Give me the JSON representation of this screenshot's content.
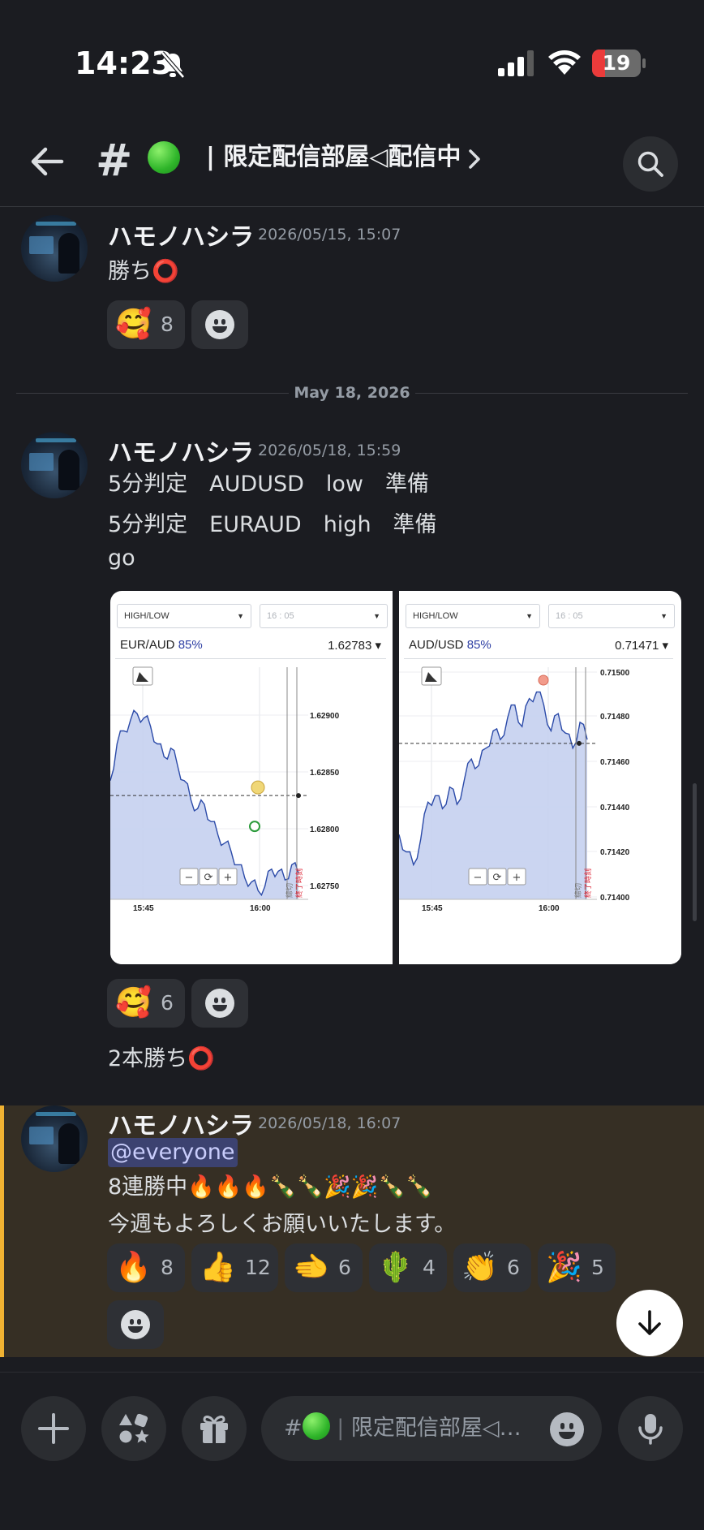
{
  "status_bar": {
    "time": "14:23",
    "battery": "19"
  },
  "header": {
    "hash": "#",
    "channel_name": "| 限定配信部屋◁配信中"
  },
  "messages": [
    {
      "author": "ハモノハシラ",
      "timestamp": "2026/05/15, 15:07",
      "lines": [
        "勝ち⭕"
      ],
      "reactions": [
        {
          "emoji": "🥰",
          "count": "8"
        }
      ]
    },
    {
      "author": "ハモノハシラ",
      "timestamp": "2026/05/18, 15:59",
      "lines": [
        "5分判定　AUDUSD　low　準備",
        "5分判定　EURAUD　high　準備",
        "go"
      ],
      "reactions": [
        {
          "emoji": "🥰",
          "count": "6"
        }
      ],
      "followup": "2本勝ち⭕"
    },
    {
      "author": "ハモノハシラ",
      "timestamp": "2026/05/18, 16:07",
      "mention": "@everyone",
      "lines": [
        "8連勝中🔥🔥🔥🍾🍾🎉🎉🍾🍾",
        "今週もよろしくお願いいたします。"
      ],
      "reactions": [
        {
          "emoji": "🔥",
          "count": "8"
        },
        {
          "emoji": "👍",
          "count": "12"
        },
        {
          "emoji": "🫲",
          "count": "6"
        },
        {
          "emoji": "🌵",
          "count": "4"
        },
        {
          "emoji": "👏",
          "count": "6"
        },
        {
          "emoji": "🎉",
          "count": "5"
        }
      ]
    }
  ],
  "date_divider": "May 18, 2026",
  "charts": [
    {
      "select_type": "HIGH/LOW",
      "select_time": "16 : 05",
      "pair": "EUR/AUD",
      "payout": "85%",
      "price": "1.62783",
      "y_ticks": [
        "1.62900",
        "1.62850",
        "1.62800",
        "1.62750"
      ],
      "x_ticks": [
        "15:45",
        "16:00"
      ],
      "end_label": "終了時刻",
      "cutoff_label": "締切"
    },
    {
      "select_type": "HIGH/LOW",
      "select_time": "16 : 05",
      "pair": "AUD/USD",
      "payout": "85%",
      "price": "0.71471",
      "y_ticks": [
        "0.71500",
        "0.71480",
        "0.71460",
        "0.71440",
        "0.71420",
        "0.71400"
      ],
      "x_ticks": [
        "15:45",
        "16:00"
      ],
      "end_label": "終了時刻",
      "cutoff_label": "締切"
    }
  ],
  "composer": {
    "placeholder": "限定配信部屋◁…",
    "prefix": "#"
  },
  "colors": {
    "background": "#1b1c21",
    "highlight": "#362f24",
    "highlight_bar": "#f0b232",
    "mention_bg": "#3c4270",
    "chart_fill": "#c8d3f0",
    "chart_line": "#2b4aa8"
  }
}
